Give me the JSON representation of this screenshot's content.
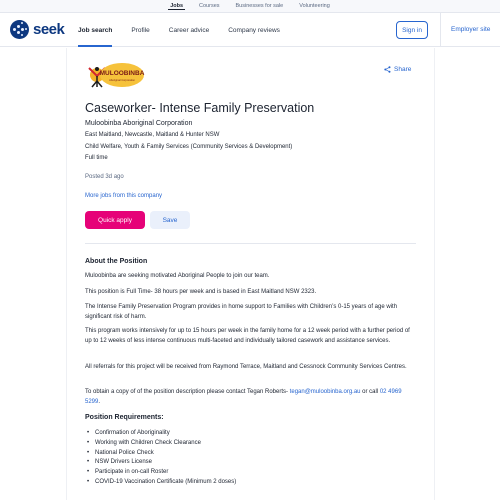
{
  "topbar": {
    "links": [
      "Jobs",
      "Courses",
      "Businesses for sale",
      "Volunteering"
    ]
  },
  "header": {
    "logo_text": "seek",
    "nav": [
      "Job search",
      "Profile",
      "Career advice",
      "Company reviews"
    ],
    "sign_in": "Sign in",
    "employer_site": "Employer site"
  },
  "job": {
    "company_logo_icon": "muloobinba-logo",
    "share_label": "Share",
    "title": "Caseworker- Intense Family Preservation",
    "advertiser": "Muloobinba Aboriginal Corporation",
    "location": "East Maitland, Newcastle, Maitland & Hunter NSW",
    "classification": "Child Welfare, Youth & Family Services (Community Services & Development)",
    "work_type": "Full time",
    "posted": "Posted 3d ago",
    "more_jobs": "More jobs from this company",
    "apply_label": "Quick apply",
    "save_label": "Save"
  },
  "description": {
    "about_heading": "About the Position",
    "paragraphs": [
      "Muloobinba are seeking motivated Aboriginal People to join our team.",
      "This position is Full Time- 38 hours per week and is based in East Maitland NSW 2323.",
      "The Intense Family Preservation Program provides in home support to Families with Children’s 0-15 years of age with significant risk of harm.",
      "This program works intensively for up to 15 hours per week in the family home for a 12 week period with a further period of up to 12 weeks of less intense continuous multi-faceted and individually tailored casework and assistance services.",
      "All referrals for this project will be received from Raymond Terrace, Maitland and Cessnock Community Services Centres."
    ],
    "contact_text": "To obtain a copy of of the position description please contact Tegan Roberts- ",
    "contact_email": "tegan@muloobinba.org.au",
    "contact_or": " or call ",
    "contact_phone": "02 4969 5299",
    "contact_end": ".",
    "requirements_heading": "Position Requirements:",
    "requirements": [
      "Confirmation of Aboriginality",
      "Working with Children Check Clearance",
      "National Police Check",
      "NSW Drivers License",
      "Participate in on-call Roster",
      "COVID-19 Vaccination Certificate (Minimum 2 doses)"
    ]
  },
  "colors": {
    "brand": "#0d3880",
    "link": "#2765cf",
    "apply": "#e60278"
  }
}
